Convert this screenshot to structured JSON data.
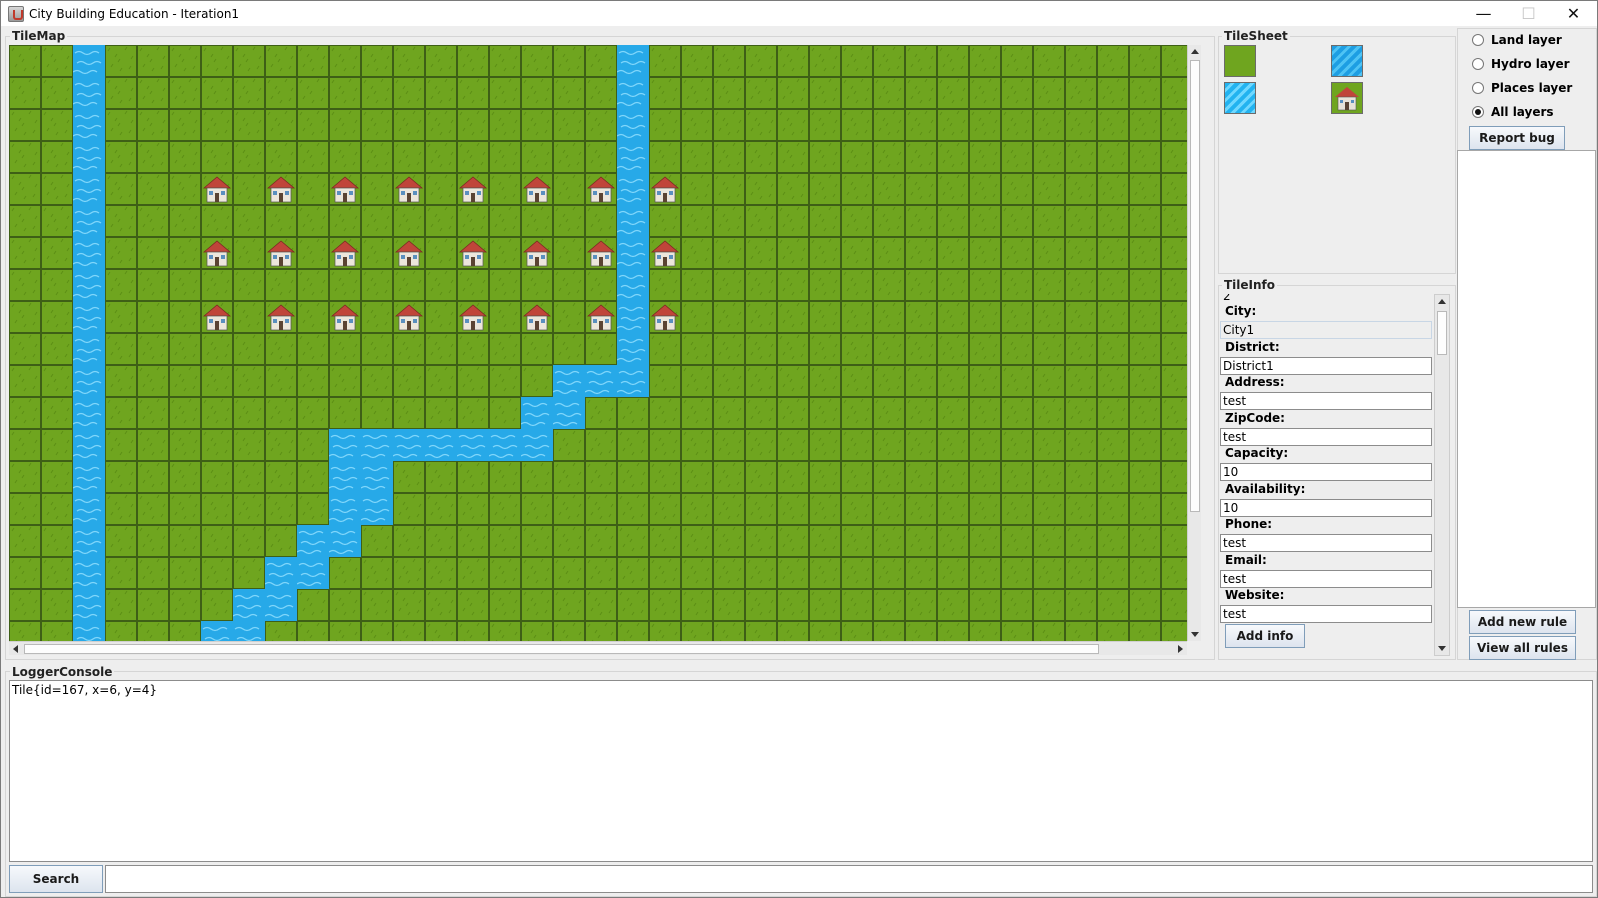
{
  "window": {
    "title": "City Building Education - Iteration1",
    "minimize": "—",
    "maximize": "☐",
    "close": "✕"
  },
  "tilemap": {
    "label": "TileMap",
    "tiles": {
      "grass_color": "#6fa51f",
      "water_color": "#27a9e8",
      "house_roof_color": "#c0453a"
    },
    "water": [
      [
        2,
        0
      ],
      [
        2,
        1
      ],
      [
        2,
        2
      ],
      [
        2,
        3
      ],
      [
        2,
        4
      ],
      [
        2,
        5
      ],
      [
        2,
        6
      ],
      [
        2,
        7
      ],
      [
        2,
        8
      ],
      [
        2,
        9
      ],
      [
        2,
        10
      ],
      [
        2,
        11
      ],
      [
        2,
        12
      ],
      [
        2,
        13
      ],
      [
        2,
        14
      ],
      [
        2,
        15
      ],
      [
        2,
        16
      ],
      [
        2,
        17
      ],
      [
        2,
        18
      ],
      [
        19,
        0
      ],
      [
        19,
        1
      ],
      [
        19,
        2
      ],
      [
        19,
        3
      ],
      [
        19,
        4
      ],
      [
        19,
        5
      ],
      [
        19,
        6
      ],
      [
        19,
        7
      ],
      [
        19,
        8
      ],
      [
        19,
        9
      ],
      [
        19,
        10
      ],
      [
        17,
        10
      ],
      [
        18,
        10
      ],
      [
        16,
        11
      ],
      [
        17,
        11
      ],
      [
        10,
        12
      ],
      [
        11,
        12
      ],
      [
        12,
        12
      ],
      [
        13,
        12
      ],
      [
        14,
        12
      ],
      [
        15,
        12
      ],
      [
        16,
        12
      ],
      [
        10,
        13
      ],
      [
        11,
        13
      ],
      [
        10,
        14
      ],
      [
        11,
        14
      ],
      [
        9,
        15
      ],
      [
        10,
        15
      ],
      [
        8,
        16
      ],
      [
        9,
        16
      ],
      [
        7,
        17
      ],
      [
        8,
        17
      ],
      [
        6,
        18
      ],
      [
        7,
        18
      ]
    ],
    "houses": [
      [
        6,
        4
      ],
      [
        8,
        4
      ],
      [
        10,
        4
      ],
      [
        12,
        4
      ],
      [
        14,
        4
      ],
      [
        16,
        4
      ],
      [
        18,
        4
      ],
      [
        20,
        4
      ],
      [
        6,
        6
      ],
      [
        8,
        6
      ],
      [
        10,
        6
      ],
      [
        12,
        6
      ],
      [
        14,
        6
      ],
      [
        16,
        6
      ],
      [
        18,
        6
      ],
      [
        20,
        6
      ],
      [
        6,
        8
      ],
      [
        8,
        8
      ],
      [
        10,
        8
      ],
      [
        12,
        8
      ],
      [
        14,
        8
      ],
      [
        16,
        8
      ],
      [
        18,
        8
      ],
      [
        20,
        8
      ]
    ],
    "cols": 37,
    "rows": 19
  },
  "tilesheet": {
    "label": "TileSheet",
    "swatches": [
      "grass",
      "water",
      "water-light",
      "house"
    ]
  },
  "tileinfo": {
    "label": "TileInfo",
    "top_value": "2",
    "fields": [
      {
        "label": "City:",
        "value": "City1",
        "readonly": true
      },
      {
        "label": "District:",
        "value": "District1"
      },
      {
        "label": "Address:",
        "value": "test"
      },
      {
        "label": "ZipCode:",
        "value": "test"
      },
      {
        "label": "Capacity:",
        "value": "10"
      },
      {
        "label": "Availability:",
        "value": "10"
      },
      {
        "label": "Phone:",
        "value": "test"
      },
      {
        "label": "Email:",
        "value": "test"
      },
      {
        "label": "Website:",
        "value": "test"
      }
    ],
    "add_info_label": "Add info"
  },
  "layers": {
    "options": [
      {
        "label": "Land layer",
        "checked": false
      },
      {
        "label": "Hydro layer",
        "checked": false
      },
      {
        "label": "Places layer",
        "checked": false
      },
      {
        "label": "All layers",
        "checked": true
      }
    ]
  },
  "rules": {
    "report_bug_label": "Report bug",
    "add_rule_label": "Add new rule",
    "view_rules_label": "View all rules"
  },
  "logger": {
    "label": "LoggerConsole",
    "text": "Tile{id=167, x=6, y=4}"
  },
  "search": {
    "button_label": "Search",
    "value": ""
  }
}
